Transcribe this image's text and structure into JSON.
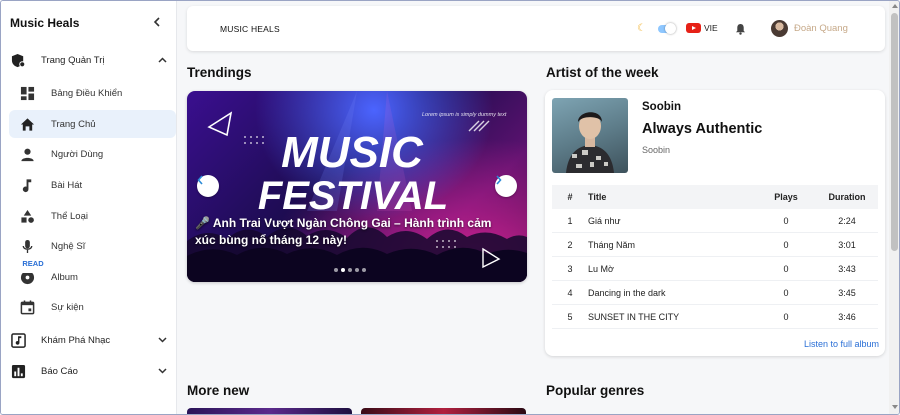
{
  "app": {
    "title": "Music Heals"
  },
  "sidebar": {
    "groups": [
      {
        "label": "Trang Quản Trị",
        "icon": "admin-shield-icon",
        "expanded": true
      },
      {
        "label": "Khám Phá Nhạc",
        "icon": "music-library-icon",
        "expanded": false
      },
      {
        "label": "Báo Cáo",
        "icon": "bar-chart-icon",
        "expanded": false
      }
    ],
    "items": [
      {
        "label": "Bảng Điều Khiển",
        "icon": "dashboard-icon"
      },
      {
        "label": "Trang Chủ",
        "icon": "home-icon",
        "active": true
      },
      {
        "label": "Người Dùng",
        "icon": "person-icon"
      },
      {
        "label": "Bài Hát",
        "icon": "music-note-icon"
      },
      {
        "label": "Thể Loại",
        "icon": "category-shapes-icon"
      },
      {
        "label": "Nghệ Sĩ",
        "icon": "microphone-icon"
      },
      {
        "label": "Album",
        "icon": "album-disc-icon"
      },
      {
        "label": "Sự kiện",
        "icon": "calendar-icon"
      }
    ]
  },
  "header": {
    "brand": "MUSIC HEALS",
    "language": "VIE",
    "user_name": "Đoàn Quang",
    "dark_mode": "on"
  },
  "trending": {
    "title": "Trendings",
    "banner_word_1": "MUSIC",
    "banner_word_2": "FESTIVAL",
    "banner_tagline": "Lorem ipsum is simply dummy text",
    "caption": "🎤 Anh Trai Vượt Ngàn Chông Gai – Hành trình cảm xúc bùng nổ tháng 12 này!",
    "read_label": "READ",
    "slide_count": 5,
    "active_slide": 1
  },
  "artist_week": {
    "title": "Artist of the week",
    "artist_name": "Soobin",
    "album_title": "Always Authentic",
    "album_artist": "Soobin",
    "columns": {
      "num": "#",
      "title": "Title",
      "plays": "Plays",
      "duration": "Duration"
    },
    "tracks": [
      {
        "num": "1",
        "title": "Giá như",
        "plays": "0",
        "duration": "2:24"
      },
      {
        "num": "2",
        "title": "Tháng Năm",
        "plays": "0",
        "duration": "3:01"
      },
      {
        "num": "3",
        "title": "Lu Mờ",
        "plays": "0",
        "duration": "3:43"
      },
      {
        "num": "4",
        "title": "Dancing in the dark",
        "plays": "0",
        "duration": "3:45"
      },
      {
        "num": "5",
        "title": "SUNSET IN THE CITY",
        "plays": "0",
        "duration": "3:46"
      }
    ],
    "full_album_label": "Listen to full album"
  },
  "more_new": {
    "title": "More new"
  },
  "popular_genres": {
    "title": "Popular genres"
  },
  "colors": {
    "accent": "#2a6fd6",
    "active_bg": "#e9f1fb",
    "username": "#c6a989"
  }
}
